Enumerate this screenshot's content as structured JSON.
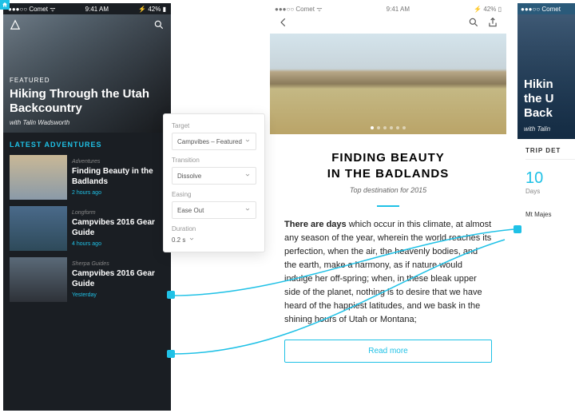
{
  "status": {
    "carrier": "Comet",
    "time": "9:41 AM",
    "battery": "42%",
    "signal": "●●●○○"
  },
  "screen1": {
    "featured_tag": "FEATURED",
    "featured_title": "Hiking Through the Utah Backcountry",
    "featured_with": "with Talin Wadsworth",
    "section": "LATEST ADVENTURES",
    "items": [
      {
        "category": "Adventures",
        "title": "Finding Beauty in the Badlands",
        "time": "2 hours ago"
      },
      {
        "category": "Longform",
        "title": "Campvibes 2016 Gear Guide",
        "time": "4 hours ago"
      },
      {
        "category": "Sherpa Guides",
        "title": "Campvibes 2016 Gear Guide",
        "time": "Yesterday"
      }
    ]
  },
  "popover": {
    "target_label": "Target",
    "target_value": "Campvibes – Featured",
    "transition_label": "Transition",
    "transition_value": "Dissolve",
    "easing_label": "Easing",
    "easing_value": "Ease Out",
    "duration_label": "Duration",
    "duration_value": "0.2 s"
  },
  "screen2": {
    "title_l1": "FINDING BEAUTY",
    "title_l2": "IN THE BADLANDS",
    "subtitle": "Top destination for 2015",
    "lead": "There are days",
    "prose": " which occur in this climate, at almost any season of the year, wherein the world reaches its perfection, when the air, the heavenly bodies, and the earth, make a harmony, as if nature would indulge her off-spring; when, in these bleak upper side of the planet, nothing is to desire that we have heard of the happiest latitudes, and we bask in the shining hours of Utah or Montana;",
    "readmore": "Read more"
  },
  "screen3": {
    "title": "Hiking the Utah Backcountry",
    "with": "with Talin",
    "panel_head": "TRIP DETAILS",
    "stat_num": "10",
    "stat_label": "Days",
    "location": "Mt Majestic"
  }
}
